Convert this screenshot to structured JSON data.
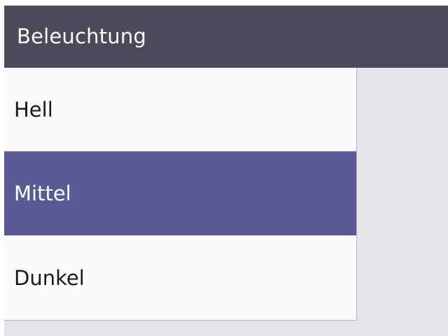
{
  "header": {
    "title": "Beleuchtung"
  },
  "menu": {
    "items": [
      {
        "label": "Hell",
        "selected": false
      },
      {
        "label": "Mittel",
        "selected": true
      },
      {
        "label": "Dunkel",
        "selected": false
      }
    ]
  },
  "colors": {
    "header_bg": "#4b4a5a",
    "selected_bg": "#5a5b96",
    "list_bg": "#fbf9fb",
    "screen_bg": "#e5e4ea"
  }
}
